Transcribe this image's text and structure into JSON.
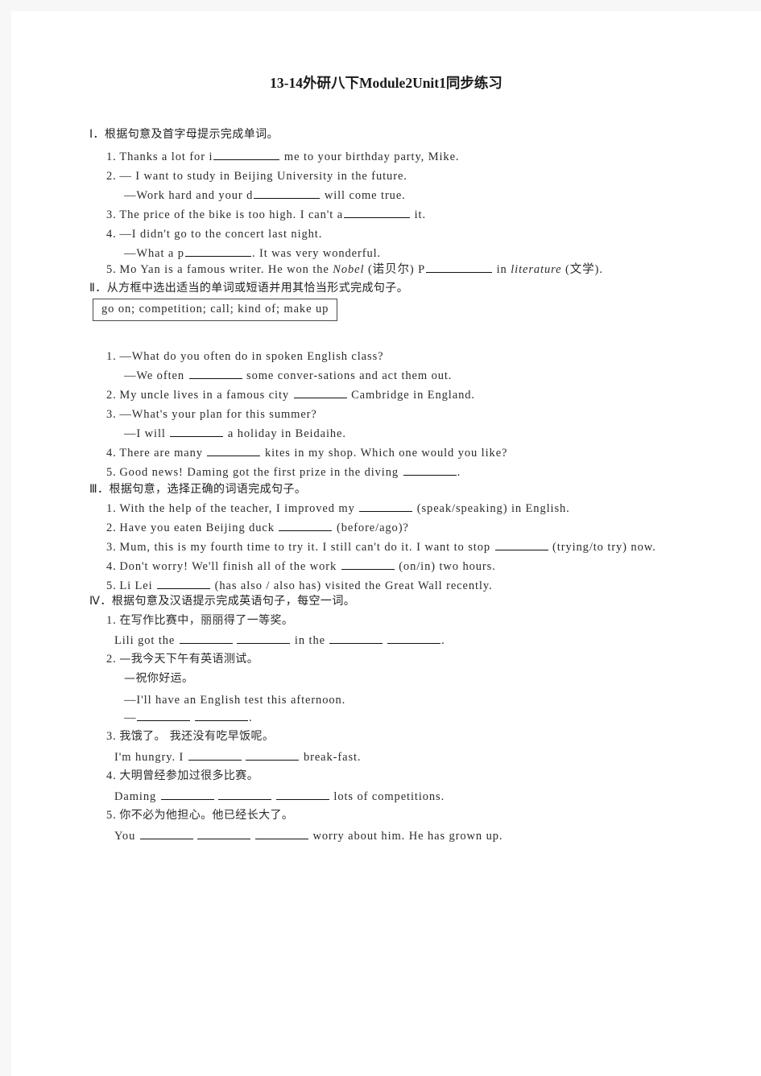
{
  "document": {
    "title": "13-14外研八下Module2Unit1同步练习"
  },
  "sections": [
    {
      "heading": "Ⅰ．根据句意及首字母提示完成单词。",
      "items": [
        {
          "num": "1.",
          "pre": "Thanks a lot for i",
          "post": " me to your birthday party, Mike."
        },
        {
          "num": "2.",
          "line1": "— I want to study in Beijing University in the future.",
          "pre2": "—Work hard and your d",
          "post2": " will come true."
        },
        {
          "num": "3.",
          "pre": "The price of the bike is too high. I can't a",
          "post": " it."
        },
        {
          "num": "4.",
          "line1": "—I didn't go to the concert last night.",
          "pre2": "—What a p",
          "post2": ". It was very wonderful."
        },
        {
          "num": "5.",
          "pre": "Mo Yan is a famous writer. He won the ",
          "italic1": "Nobel",
          "mid": " (诺贝尔) P",
          "post": " in ",
          "italic2": "literature",
          "tail": " (文学)."
        }
      ]
    },
    {
      "heading": "Ⅱ．从方框中选出适当的单词或短语并用其恰当形式完成句子。",
      "wordbank": "go on; competition; call; kind of; make up",
      "items": [
        {
          "num": "1.",
          "line1": "—What do you often do in spoken English class?",
          "pre2": "—We often ",
          "post2": " some conver-sations and act them out."
        },
        {
          "num": "2.",
          "pre": "My uncle lives in a famous city ",
          "post": " Cambridge in England."
        },
        {
          "num": "3.",
          "line1": "—What's your plan for this summer?",
          "pre2": "—I will ",
          "post2": " a holiday in Beidaihe."
        },
        {
          "num": "4.",
          "pre": "There are many ",
          "post": " kites in my shop. Which one would you like?"
        },
        {
          "num": "5.",
          "pre": "Good news! Daming got the first prize in the diving ",
          "post": "."
        }
      ]
    },
    {
      "heading": "Ⅲ．根据句意，选择正确的词语完成句子。",
      "items": [
        {
          "num": "1.",
          "pre": "With the help of the teacher, I improved my ",
          "post": " (speak/speaking) in English."
        },
        {
          "num": "2.",
          "pre": "Have you eaten Beijing duck ",
          "post": " (before/ago)?"
        },
        {
          "num": "3.",
          "pre": "Mum, this is my fourth time to try it. I still can't do it. I want to stop ",
          "post": " (trying/to try) now."
        },
        {
          "num": "4.",
          "pre": "Don't worry! We'll finish all of the work ",
          "post": " (on/in) two hours."
        },
        {
          "num": "5.",
          "pre": "Li Lei ",
          "post": " (has also / also has) visited the Great Wall recently."
        }
      ]
    },
    {
      "heading": "Ⅳ．根据句意及汉语提示完成英语句子，每空一词。",
      "items": [
        {
          "num": "1.",
          "cn": "在写作比赛中，丽丽得了一等奖。",
          "pre": "Lili got the ",
          "mid": " in the ",
          "post": "."
        },
        {
          "num": "2.",
          "cn": "—我今天下午有英语测试。",
          "cn2": "—祝你好运。",
          "en1": "—I'll have an English test this afternoon.",
          "pre": "—",
          "post": "."
        },
        {
          "num": "3.",
          "cn": "我饿了。 我还没有吃早饭呢。",
          "pre": "I'm hungry. I ",
          "post": " break-fast."
        },
        {
          "num": "4.",
          "cn": "大明曾经参加过很多比赛。",
          "pre": "Daming ",
          "post": " lots of competitions."
        },
        {
          "num": "5.",
          "cn": "你不必为他担心。他已经长大了。",
          "pre": "You ",
          "post": " worry about him. He has grown up."
        }
      ]
    }
  ]
}
